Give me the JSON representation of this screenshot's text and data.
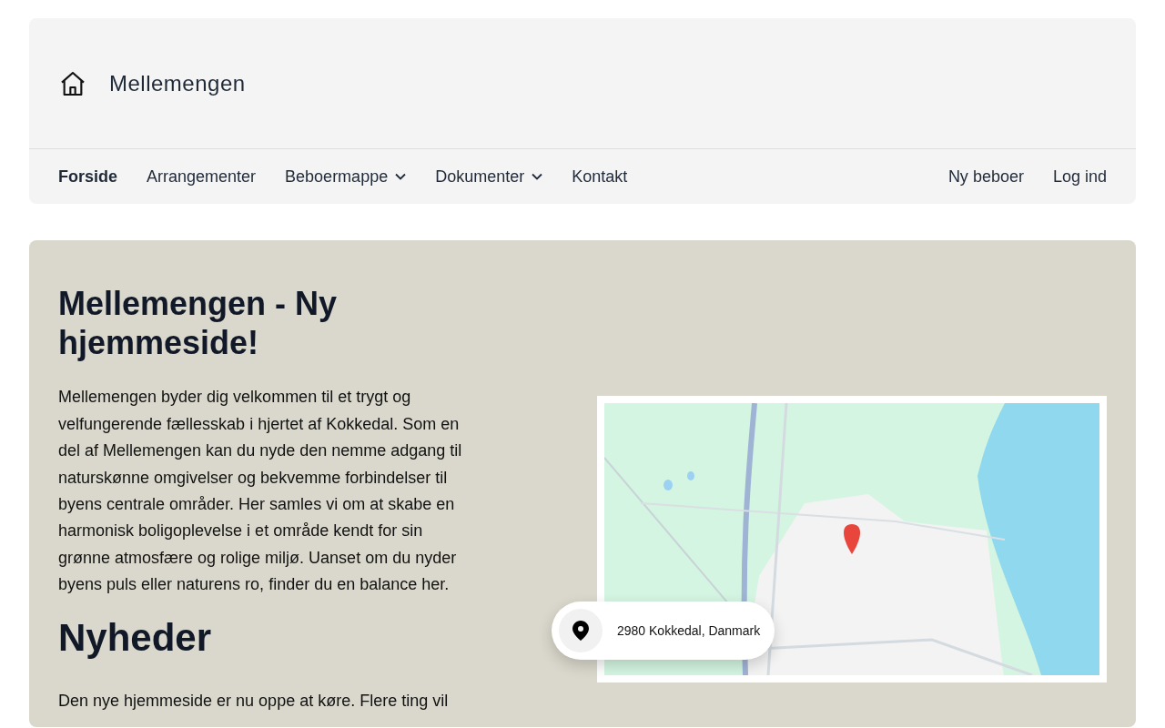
{
  "header": {
    "brand": "Mellemengen"
  },
  "nav": {
    "items": [
      {
        "label": "Forside",
        "selected": true,
        "dropdown": false
      },
      {
        "label": "Arrangementer",
        "selected": false,
        "dropdown": false
      },
      {
        "label": "Beboermappe",
        "selected": false,
        "dropdown": true
      },
      {
        "label": "Dokumenter",
        "selected": false,
        "dropdown": true
      },
      {
        "label": "Kontakt",
        "selected": false,
        "dropdown": false
      }
    ],
    "right_links": [
      "Ny beboer",
      "Log ind"
    ]
  },
  "hero": {
    "title": "Mellemengen - Ny hjemmeside!",
    "intro": "Mellemengen byder dig velkommen til et trygt og velfungerende fællesskab i hjertet af Kokkedal. Som en del af Mellemengen kan du nyde den nemme adgang til naturskønne omgivelser og bekvemme forbindelser til byens centrale områder. Her samles vi om at skabe en harmonisk boligoplevelse i et område kendt for sin grønne atmosfære og rolige miljø. Uanset om du nyder byens puls eller naturens ro, finder du en balance her.",
    "news_heading": "Nyheder",
    "news_text": "Den nye hjemmeside er nu oppe at køre. Flere ting vil",
    "map": {
      "kind": "picture",
      "address": "2980 Kokkedal, Danmark"
    }
  }
}
